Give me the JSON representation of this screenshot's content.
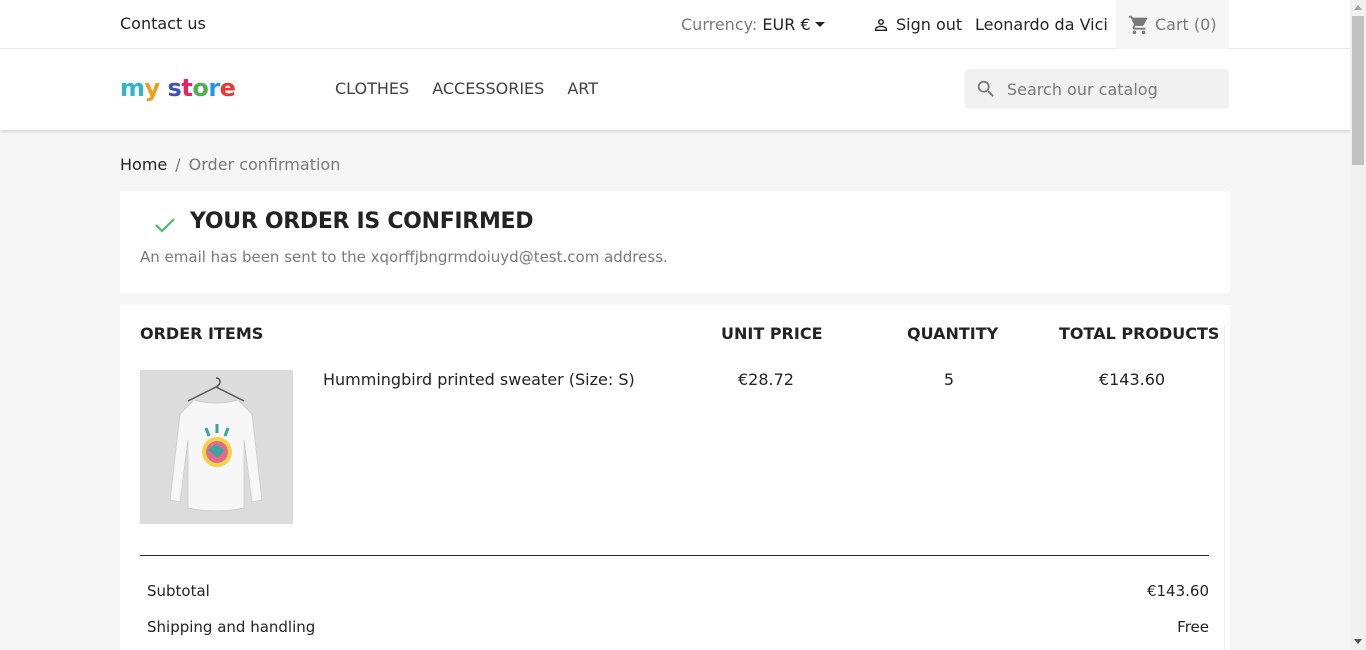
{
  "topbar": {
    "contact": "Contact us",
    "currency_label": "Currency:",
    "currency_value": "EUR €",
    "sign_out": "Sign out",
    "user_name": "Leonardo da Vici",
    "cart": "Cart (0)"
  },
  "header": {
    "logo": "my store",
    "nav": [
      "CLOTHES",
      "ACCESSORIES",
      "ART"
    ],
    "search_placeholder": "Search our catalog"
  },
  "breadcrumb": {
    "home": "Home",
    "separator": "/",
    "current": "Order confirmation"
  },
  "confirmation": {
    "title": "YOUR ORDER IS CONFIRMED",
    "message": "An email has been sent to the xqorffjbngrmdoiuyd@test.com address."
  },
  "order": {
    "headers": {
      "items": "ORDER ITEMS",
      "unit_price": "UNIT PRICE",
      "quantity": "QUANTITY",
      "total": "TOTAL PRODUCTS"
    },
    "items": [
      {
        "name": "Hummingbird printed sweater (Size: S)",
        "unit_price": "€28.72",
        "quantity": "5",
        "total": "€143.60"
      }
    ],
    "summary": [
      {
        "label": "Subtotal",
        "value": "€143.60"
      },
      {
        "label": "Shipping and handling",
        "value": "Free"
      }
    ]
  },
  "colors": {
    "accent": "#24b9d7",
    "check": "#4cbb6c",
    "background": "#f6f6f6"
  }
}
